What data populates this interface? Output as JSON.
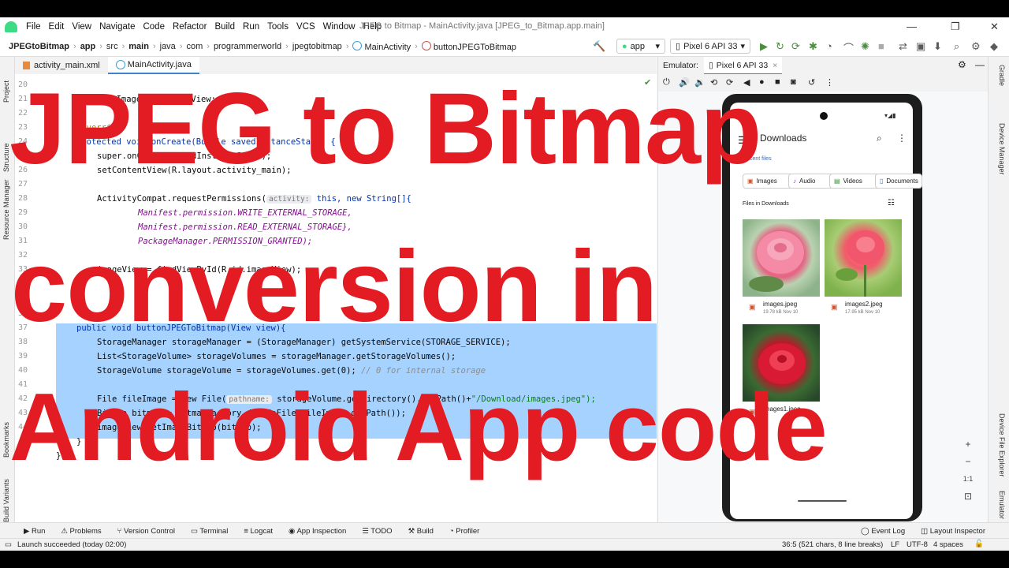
{
  "window": {
    "title": "JPEG to Bitmap - MainActivity.java [JPEG_to_Bitmap.app.main]"
  },
  "menu": [
    "File",
    "Edit",
    "View",
    "Navigate",
    "Code",
    "Refactor",
    "Build",
    "Run",
    "Tools",
    "VCS",
    "Window",
    "Help"
  ],
  "breadcrumb": [
    "JPEGtoBitmap",
    "app",
    "src",
    "main",
    "java",
    "com",
    "programmerworld",
    "jpegtobitmap",
    "MainActivity",
    "buttonJPEGToBitmap"
  ],
  "toolbar": {
    "run_config": "app",
    "device": "Pixel 6 API 33"
  },
  "left_stripe": [
    "Project",
    "Structure",
    "Resource Manager",
    "Bookmarks",
    "Build Variants"
  ],
  "right_stripe": [
    "Gradle",
    "Device Manager",
    "Device File Explorer",
    "Emulator"
  ],
  "editor_tabs": [
    "activity_main.xml",
    "MainActivity.java"
  ],
  "line_numbers": [
    "20",
    "21",
    "22",
    "23",
    "24",
    "25",
    "26",
    "27",
    "28",
    "29",
    "30",
    "31",
    "32",
    "33",
    "36",
    "37",
    "38",
    "39",
    "40",
    "41",
    "42",
    "43",
    "44",
    "45",
    "46"
  ],
  "code": {
    "l21": "private ImageView imageView;",
    "l23": "@Override",
    "l24": "protected void onCreate(Bundle savedInstanceState) {",
    "l25": "super.onCreate(savedInstanceState);",
    "l26": "setContentView(R.layout.activity_main);",
    "l28": "ActivityCompat.requestPermissions(",
    "l28_hint": "activity:",
    "l28_rest": "this, new String[]{",
    "l29": "Manifest.permission.WRITE_EXTERNAL_STORAGE,",
    "l30": "Manifest.permission.READ_EXTERNAL_STORAGE},",
    "l31": "PackageManager.PERMISSION_GRANTED);",
    "l33": "imageView = findViewById(R.id.imageView);",
    "l36": "public void buttonJPEGToBitmap(View view){",
    "l37": "StorageManager storageManager = (StorageManager) getSystemService(STORAGE_SERVICE);",
    "l38": "List<StorageVolume> storageVolumes = storageManager.getStorageVolumes();",
    "l39": "StorageVolume storageVolume = storageVolumes.get(0);",
    "l39_comment": "// 0 for internal storage",
    "l41a": "File fileImage = new File(",
    "l41_hint": "pathname:",
    "l41b": "storageVolume.getDirectory().getPath()+",
    "l41_str": "\"/Download/images.jpeg\");",
    "l42": "Bitmap bitmap = BitmapFactory.decodeFile(fileImage.getPath());",
    "l43": "imageView.setImageBitmap(bitmap);",
    "l44": "}",
    "l45": "}"
  },
  "emulator": {
    "label": "Emulator:",
    "device_tab": "Pixel 6 API 33",
    "app_title": "Downloads",
    "recent_label": "Recent files",
    "chips": [
      "Images",
      "Audio",
      "Videos",
      "Documents"
    ],
    "files_header": "Files in Downloads",
    "files": [
      {
        "name": "images.jpeg",
        "meta": "19.78 kB Nov 10"
      },
      {
        "name": "images2.jpeg",
        "meta": "17.95 kB Nov 10"
      },
      {
        "name": "images1.jpeg",
        "meta": ""
      }
    ],
    "zoom_ratio": "1:1"
  },
  "tool_windows": [
    "Run",
    "Problems",
    "Version Control",
    "Terminal",
    "Logcat",
    "App Inspection",
    "TODO",
    "Build",
    "Profiler"
  ],
  "tool_windows_right": [
    "Event Log",
    "Layout Inspector"
  ],
  "status": {
    "message": "Launch succeeded (today 02:00)",
    "position": "36:5 (521 chars, 8 line breaks)",
    "line_sep": "LF",
    "encoding": "UTF-8",
    "indent": "4 spaces"
  },
  "overlay": {
    "line1": "JPEG to Bitmap",
    "line2": "conversion in",
    "line3": "Android App code",
    "color": "#e31b23"
  }
}
